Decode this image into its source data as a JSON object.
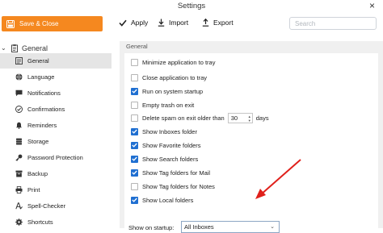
{
  "window": {
    "title": "Settings",
    "close_glyph": "×"
  },
  "toolbar": {
    "save_close": "Save & Close",
    "apply": "Apply",
    "import": "Import",
    "export": "Export",
    "search_placeholder": "Search",
    "accent": "#f5881f"
  },
  "sidebar": {
    "section": "General",
    "items": [
      {
        "label": "General",
        "icon": "list-icon"
      },
      {
        "label": "Language",
        "icon": "globe-icon"
      },
      {
        "label": "Notifications",
        "icon": "chat-icon"
      },
      {
        "label": "Confirmations",
        "icon": "check-circle-icon"
      },
      {
        "label": "Reminders",
        "icon": "bell-icon"
      },
      {
        "label": "Storage",
        "icon": "database-icon"
      },
      {
        "label": "Password Protection",
        "icon": "key-icon"
      },
      {
        "label": "Backup",
        "icon": "archive-icon"
      },
      {
        "label": "Print",
        "icon": "printer-icon"
      },
      {
        "label": "Spell-Checker",
        "icon": "spell-check-icon"
      },
      {
        "label": "Shortcuts",
        "icon": "gear-icon"
      }
    ]
  },
  "main": {
    "section": "General",
    "options": [
      {
        "label": "Minimize application to tray",
        "checked": false
      },
      {
        "label": "Close application to tray",
        "checked": false
      },
      {
        "label": "Run on system startup",
        "checked": true
      },
      {
        "label": "Empty trash on exit",
        "checked": false
      },
      {
        "label": "Delete spam on exit older than",
        "checked": false
      },
      {
        "label": "Show Inboxes folder",
        "checked": true
      },
      {
        "label": "Show Favorite folders",
        "checked": true
      },
      {
        "label": "Show Search folders",
        "checked": true
      },
      {
        "label": "Show Tag folders for Mail",
        "checked": true
      },
      {
        "label": "Show Tag folders for Notes",
        "checked": false
      },
      {
        "label": "Show Local folders",
        "checked": true
      }
    ],
    "spam_days_value": "30",
    "spam_days_unit": "days",
    "startup_label": "Show on startup:",
    "startup_value": "All Inboxes",
    "checkbox_color": "#1f6fd1",
    "arrow_color": "#e0201b"
  }
}
